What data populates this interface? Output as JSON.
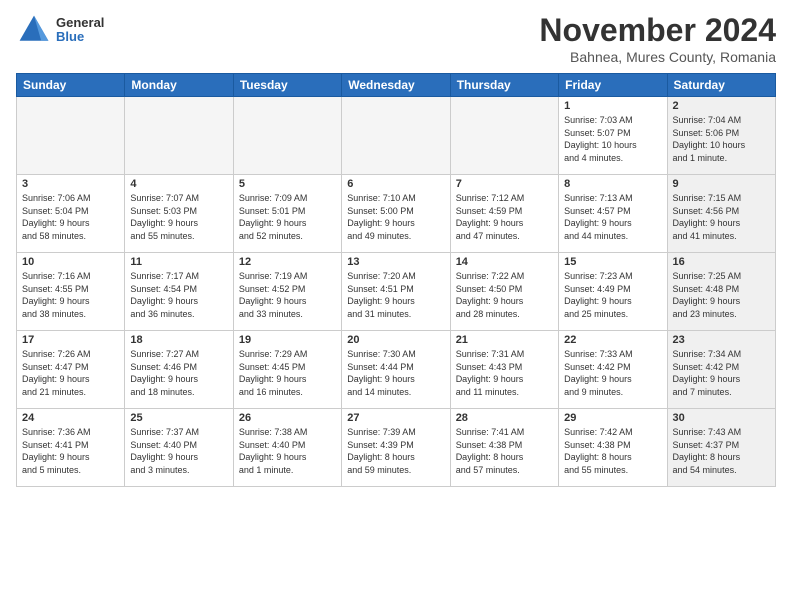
{
  "header": {
    "logo_general": "General",
    "logo_blue": "Blue",
    "month": "November 2024",
    "location": "Bahnea, Mures County, Romania"
  },
  "days_of_week": [
    "Sunday",
    "Monday",
    "Tuesday",
    "Wednesday",
    "Thursday",
    "Friday",
    "Saturday"
  ],
  "weeks": [
    [
      {
        "day": "",
        "info": "",
        "shaded": true
      },
      {
        "day": "",
        "info": "",
        "shaded": true
      },
      {
        "day": "",
        "info": "",
        "shaded": true
      },
      {
        "day": "",
        "info": "",
        "shaded": true
      },
      {
        "day": "",
        "info": "",
        "shaded": true
      },
      {
        "day": "1",
        "info": "Sunrise: 7:03 AM\nSunset: 5:07 PM\nDaylight: 10 hours\nand 4 minutes.",
        "shaded": false
      },
      {
        "day": "2",
        "info": "Sunrise: 7:04 AM\nSunset: 5:06 PM\nDaylight: 10 hours\nand 1 minute.",
        "shaded": true
      }
    ],
    [
      {
        "day": "3",
        "info": "Sunrise: 7:06 AM\nSunset: 5:04 PM\nDaylight: 9 hours\nand 58 minutes.",
        "shaded": false
      },
      {
        "day": "4",
        "info": "Sunrise: 7:07 AM\nSunset: 5:03 PM\nDaylight: 9 hours\nand 55 minutes.",
        "shaded": false
      },
      {
        "day": "5",
        "info": "Sunrise: 7:09 AM\nSunset: 5:01 PM\nDaylight: 9 hours\nand 52 minutes.",
        "shaded": false
      },
      {
        "day": "6",
        "info": "Sunrise: 7:10 AM\nSunset: 5:00 PM\nDaylight: 9 hours\nand 49 minutes.",
        "shaded": false
      },
      {
        "day": "7",
        "info": "Sunrise: 7:12 AM\nSunset: 4:59 PM\nDaylight: 9 hours\nand 47 minutes.",
        "shaded": false
      },
      {
        "day": "8",
        "info": "Sunrise: 7:13 AM\nSunset: 4:57 PM\nDaylight: 9 hours\nand 44 minutes.",
        "shaded": false
      },
      {
        "day": "9",
        "info": "Sunrise: 7:15 AM\nSunset: 4:56 PM\nDaylight: 9 hours\nand 41 minutes.",
        "shaded": true
      }
    ],
    [
      {
        "day": "10",
        "info": "Sunrise: 7:16 AM\nSunset: 4:55 PM\nDaylight: 9 hours\nand 38 minutes.",
        "shaded": false
      },
      {
        "day": "11",
        "info": "Sunrise: 7:17 AM\nSunset: 4:54 PM\nDaylight: 9 hours\nand 36 minutes.",
        "shaded": false
      },
      {
        "day": "12",
        "info": "Sunrise: 7:19 AM\nSunset: 4:52 PM\nDaylight: 9 hours\nand 33 minutes.",
        "shaded": false
      },
      {
        "day": "13",
        "info": "Sunrise: 7:20 AM\nSunset: 4:51 PM\nDaylight: 9 hours\nand 31 minutes.",
        "shaded": false
      },
      {
        "day": "14",
        "info": "Sunrise: 7:22 AM\nSunset: 4:50 PM\nDaylight: 9 hours\nand 28 minutes.",
        "shaded": false
      },
      {
        "day": "15",
        "info": "Sunrise: 7:23 AM\nSunset: 4:49 PM\nDaylight: 9 hours\nand 25 minutes.",
        "shaded": false
      },
      {
        "day": "16",
        "info": "Sunrise: 7:25 AM\nSunset: 4:48 PM\nDaylight: 9 hours\nand 23 minutes.",
        "shaded": true
      }
    ],
    [
      {
        "day": "17",
        "info": "Sunrise: 7:26 AM\nSunset: 4:47 PM\nDaylight: 9 hours\nand 21 minutes.",
        "shaded": false
      },
      {
        "day": "18",
        "info": "Sunrise: 7:27 AM\nSunset: 4:46 PM\nDaylight: 9 hours\nand 18 minutes.",
        "shaded": false
      },
      {
        "day": "19",
        "info": "Sunrise: 7:29 AM\nSunset: 4:45 PM\nDaylight: 9 hours\nand 16 minutes.",
        "shaded": false
      },
      {
        "day": "20",
        "info": "Sunrise: 7:30 AM\nSunset: 4:44 PM\nDaylight: 9 hours\nand 14 minutes.",
        "shaded": false
      },
      {
        "day": "21",
        "info": "Sunrise: 7:31 AM\nSunset: 4:43 PM\nDaylight: 9 hours\nand 11 minutes.",
        "shaded": false
      },
      {
        "day": "22",
        "info": "Sunrise: 7:33 AM\nSunset: 4:42 PM\nDaylight: 9 hours\nand 9 minutes.",
        "shaded": false
      },
      {
        "day": "23",
        "info": "Sunrise: 7:34 AM\nSunset: 4:42 PM\nDaylight: 9 hours\nand 7 minutes.",
        "shaded": true
      }
    ],
    [
      {
        "day": "24",
        "info": "Sunrise: 7:36 AM\nSunset: 4:41 PM\nDaylight: 9 hours\nand 5 minutes.",
        "shaded": false
      },
      {
        "day": "25",
        "info": "Sunrise: 7:37 AM\nSunset: 4:40 PM\nDaylight: 9 hours\nand 3 minutes.",
        "shaded": false
      },
      {
        "day": "26",
        "info": "Sunrise: 7:38 AM\nSunset: 4:40 PM\nDaylight: 9 hours\nand 1 minute.",
        "shaded": false
      },
      {
        "day": "27",
        "info": "Sunrise: 7:39 AM\nSunset: 4:39 PM\nDaylight: 8 hours\nand 59 minutes.",
        "shaded": false
      },
      {
        "day": "28",
        "info": "Sunrise: 7:41 AM\nSunset: 4:38 PM\nDaylight: 8 hours\nand 57 minutes.",
        "shaded": false
      },
      {
        "day": "29",
        "info": "Sunrise: 7:42 AM\nSunset: 4:38 PM\nDaylight: 8 hours\nand 55 minutes.",
        "shaded": false
      },
      {
        "day": "30",
        "info": "Sunrise: 7:43 AM\nSunset: 4:37 PM\nDaylight: 8 hours\nand 54 minutes.",
        "shaded": true
      }
    ]
  ]
}
